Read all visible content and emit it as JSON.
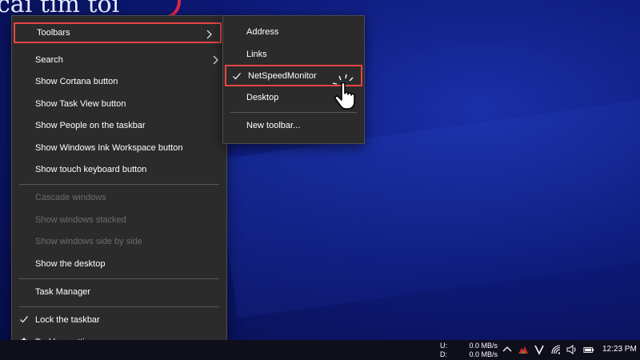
{
  "background": {
    "title_text": "cái tìm tôi"
  },
  "context_menu": {
    "items": [
      {
        "label": "Toolbars"
      },
      {
        "label": "Search"
      },
      {
        "label": "Show Cortana button"
      },
      {
        "label": "Show Task View button"
      },
      {
        "label": "Show People on the taskbar"
      },
      {
        "label": "Show Windows Ink Workspace button"
      },
      {
        "label": "Show touch keyboard button"
      },
      {
        "label": "Cascade windows"
      },
      {
        "label": "Show windows stacked"
      },
      {
        "label": "Show windows side by side"
      },
      {
        "label": "Show the desktop"
      },
      {
        "label": "Task Manager"
      },
      {
        "label": "Lock the taskbar"
      },
      {
        "label": "Taskbar settings"
      }
    ]
  },
  "toolbars_submenu": {
    "items": [
      {
        "label": "Address"
      },
      {
        "label": "Links"
      },
      {
        "label": "NetSpeedMonitor"
      },
      {
        "label": "Desktop"
      },
      {
        "label": "New toolbar..."
      }
    ]
  },
  "taskbar": {
    "upload_label": "U:",
    "download_label": "D:",
    "upload_speed": "0.0 MB/s",
    "download_speed": "0.0 MB/s",
    "time": "12:23 PM"
  },
  "colors": {
    "highlight": "#e84545",
    "menu_bg": "#2b2b2b",
    "accent_red": "#e0254a"
  },
  "icons": [
    "chevron-right-icon",
    "check-icon",
    "gear-icon",
    "hand-pointer-cursor-icon",
    "chevron-up-icon",
    "antivirus-icon",
    "v-app-icon",
    "wifi-icon",
    "speaker-icon",
    "battery-icon"
  ]
}
